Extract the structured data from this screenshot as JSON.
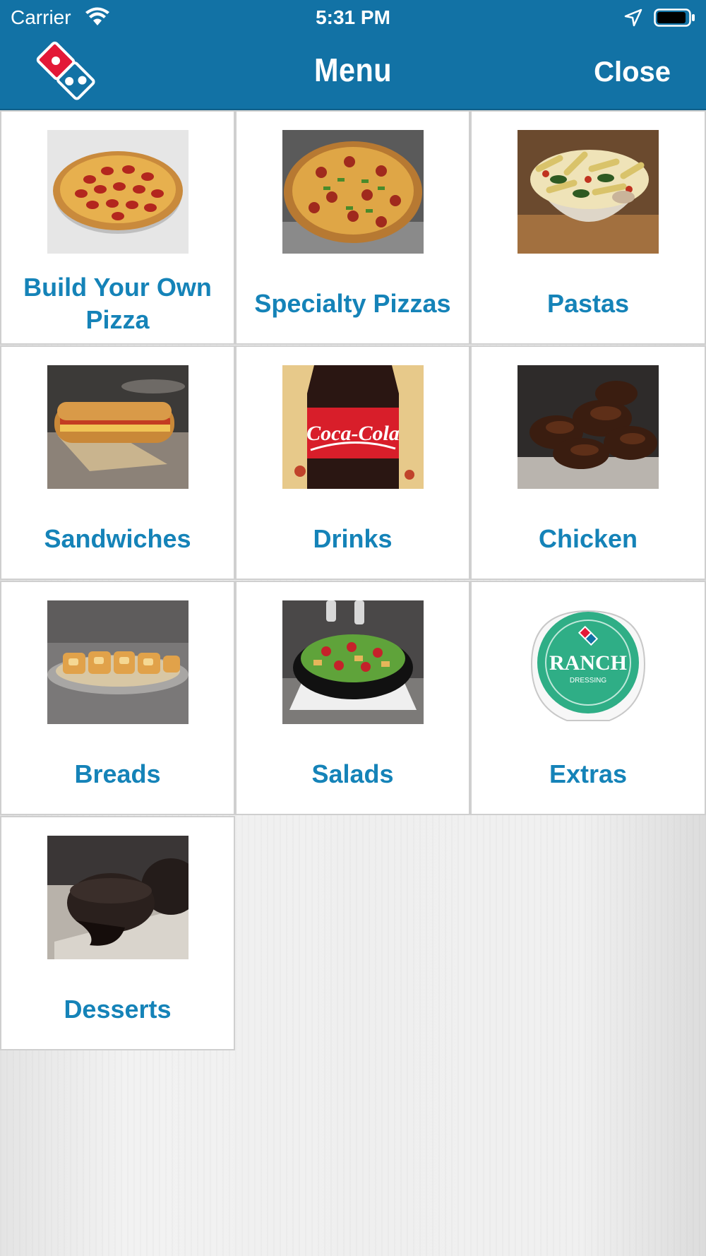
{
  "status_bar": {
    "carrier": "Carrier",
    "time": "5:31 PM"
  },
  "nav": {
    "title": "Menu",
    "close_label": "Close",
    "logo_icon": "dominos-logo-icon"
  },
  "colors": {
    "nav_background": "#1272a5",
    "label_text": "#1583b8"
  },
  "menu": {
    "items": [
      {
        "label": "Build Your Own Pizza",
        "icon": "pepperoni-pizza-image"
      },
      {
        "label": "Specialty Pizzas",
        "icon": "specialty-pizza-image"
      },
      {
        "label": "Pastas",
        "icon": "pasta-bowl-image"
      },
      {
        "label": "Sandwiches",
        "icon": "sandwich-image"
      },
      {
        "label": "Drinks",
        "icon": "soda-bottle-image"
      },
      {
        "label": "Chicken",
        "icon": "chicken-wings-image"
      },
      {
        "label": "Breads",
        "icon": "bread-twists-image"
      },
      {
        "label": "Salads",
        "icon": "salad-bowl-image"
      },
      {
        "label": "Extras",
        "icon": "ranch-dressing-image"
      },
      {
        "label": "Desserts",
        "icon": "lava-cake-image"
      }
    ]
  }
}
